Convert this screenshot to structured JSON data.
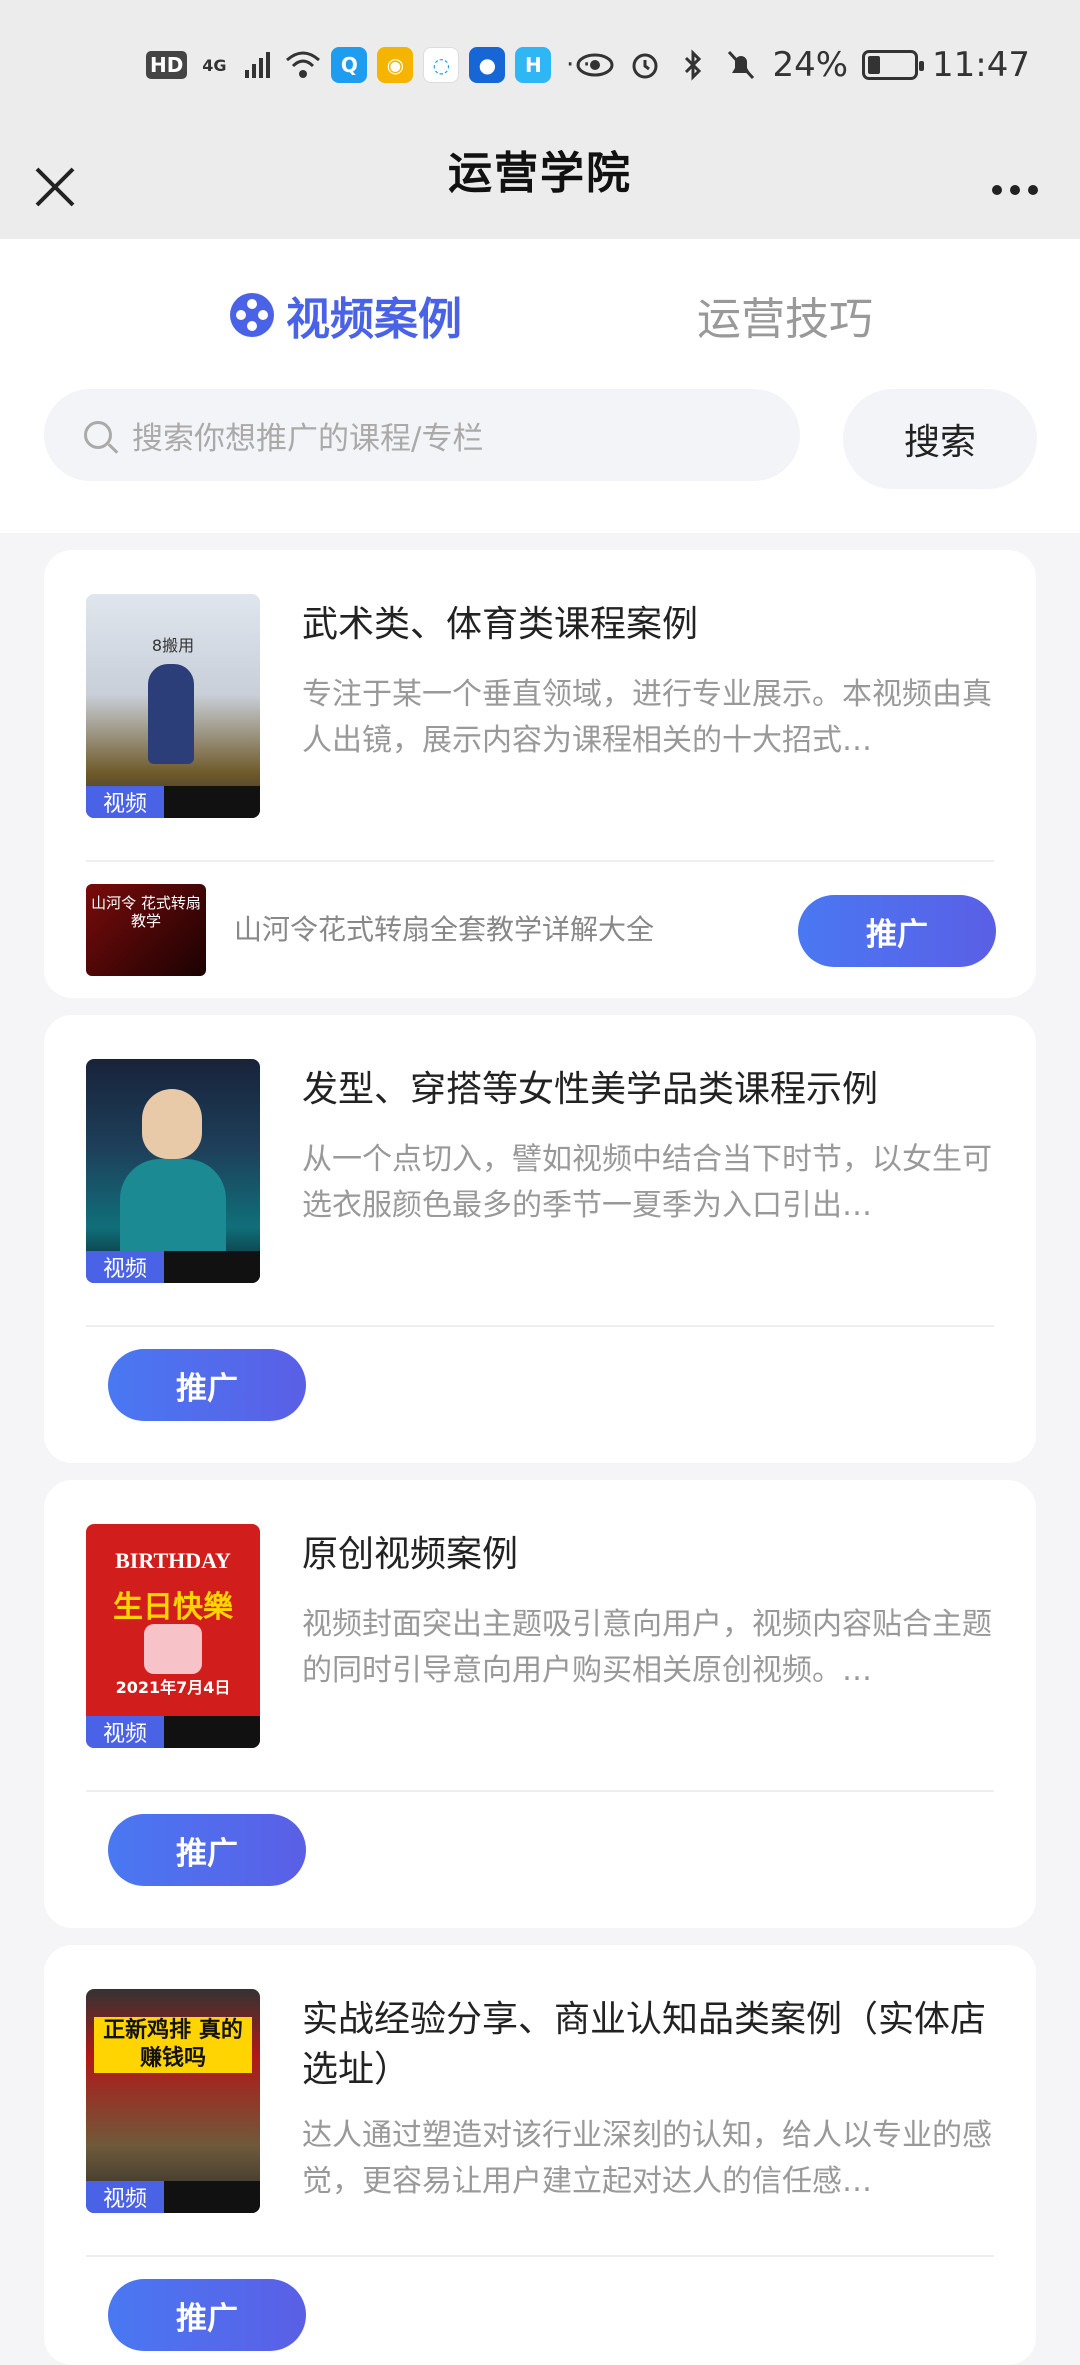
{
  "status_bar": {
    "hd": "HD",
    "network": "4G",
    "more": "···",
    "battery": "24%",
    "time": "11:47"
  },
  "nav": {
    "title": "运营学院"
  },
  "tabs": [
    {
      "label": "视频案例",
      "active": true
    },
    {
      "label": "运营技巧",
      "active": false
    }
  ],
  "search": {
    "placeholder": "搜索你想推广的课程/专栏",
    "button": "搜索"
  },
  "cards": [
    {
      "title": "武术类、体育类课程案例",
      "desc": "专注于某一个垂直领域，进行专业展示。本视频由真人出镜，展示内容为课程相关的十大招式…",
      "badge": "视频",
      "thumb_text": "8搬用",
      "course_thumb_text": "山河令 花式转扇教学",
      "course_name": "山河令花式转扇全套教学详解大全",
      "button": "推广"
    },
    {
      "title": "发型、穿搭等女性美学品类课程示例",
      "desc": "从一个点切入，譬如视频中结合当下时节，以女生可选衣服颜色最多的季节一夏季为入口引出…",
      "badge": "视频",
      "button": "推广"
    },
    {
      "title": "原创视频案例",
      "desc": "视频封面突出主题吸引意向用户，视频内容贴合主题的同时引导意向用户购买相关原创视频。…",
      "badge": "视频",
      "thumb_title": "BIRTHDAY",
      "thumb_main": "生日快樂",
      "thumb_date": "2021年7月4日",
      "button": "推广"
    },
    {
      "title": "实战经验分享、商业认知品类案例（实体店选址）",
      "desc": "达人通过塑造对该行业深刻的认知，给人以专业的感觉，更容易让用户建立起对达人的信任感…",
      "badge": "视频",
      "thumb_text": "正新鸡排 真的赚钱吗",
      "button": "推广"
    }
  ],
  "colors": {
    "accent": "#4a63e6",
    "page_bg": "#f5f5f7",
    "nav_bg": "#ececec"
  }
}
